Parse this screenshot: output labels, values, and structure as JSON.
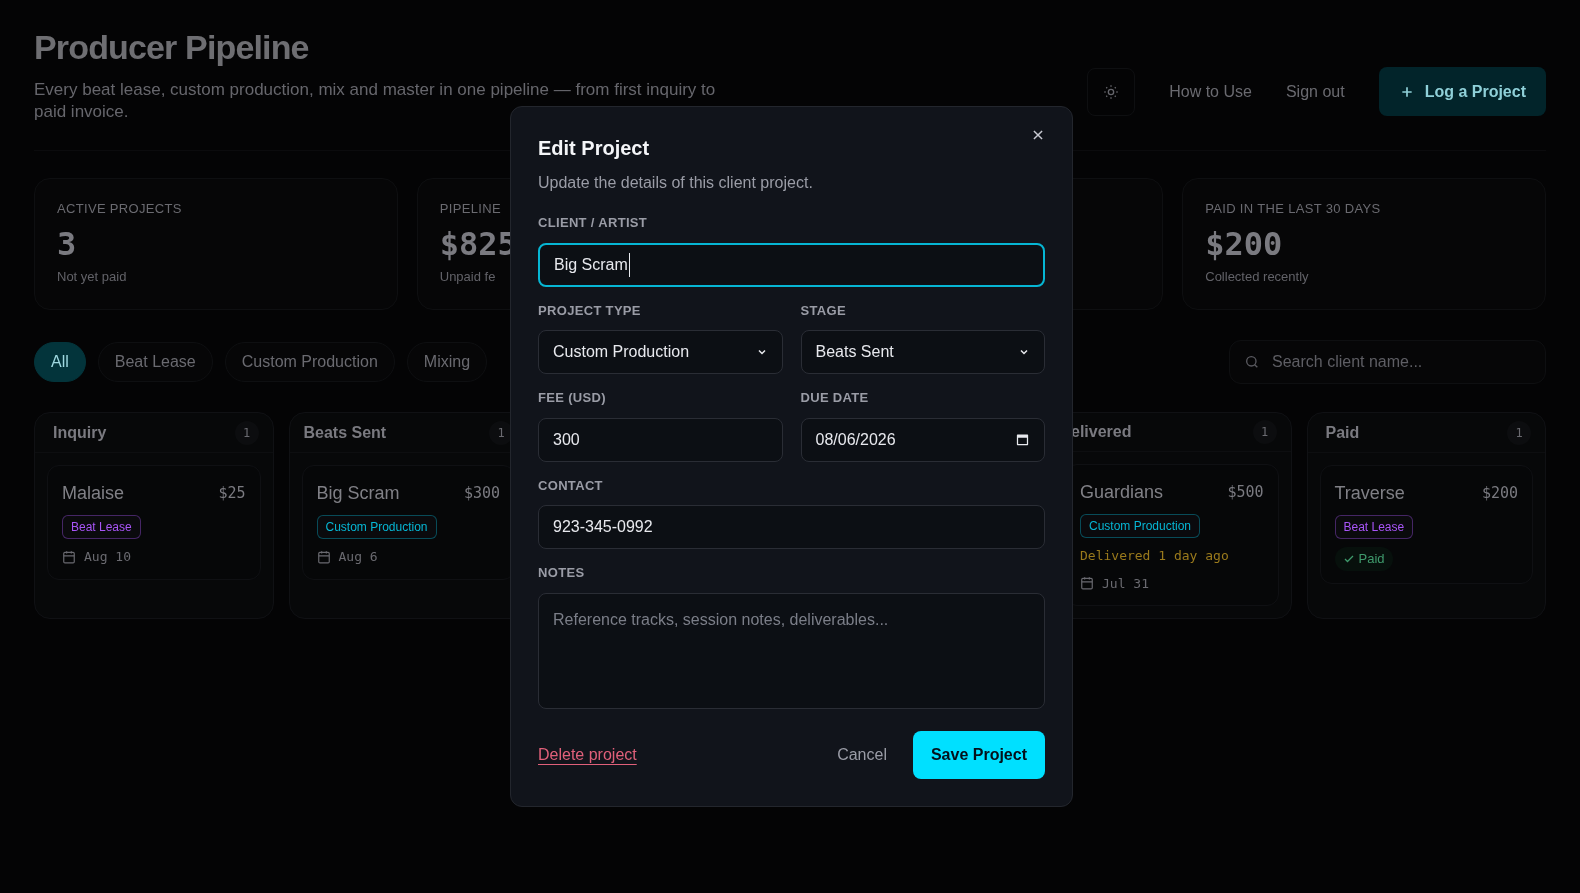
{
  "header": {
    "title": "Producer Pipeline",
    "subtitle": "Every beat lease, custom production, mix and master in one pipeline — from first inquiry to paid invoice.",
    "links": [
      "How to Use",
      "Sign out"
    ],
    "primary_button": "Log a Project"
  },
  "stats": [
    {
      "label": "ACTIVE PROJECTS",
      "value": "3",
      "caption": "Not yet paid"
    },
    {
      "label": "PIPELINE",
      "value": "$825",
      "caption": "Unpaid fe"
    },
    {
      "label": "PAID IN THE LAST 30 DAYS",
      "value": "$200",
      "caption": "Collected recently"
    }
  ],
  "filters": [
    {
      "label": "All",
      "selected": true
    },
    {
      "label": "Beat Lease",
      "selected": false
    },
    {
      "label": "Custom Production",
      "selected": false
    },
    {
      "label": "Mixing",
      "selected": false
    }
  ],
  "search": {
    "placeholder": "Search client name..."
  },
  "columns": [
    {
      "title": "Inquiry",
      "count": "1",
      "cards": [
        {
          "name": "Malaise",
          "amount": "$25",
          "tag": {
            "label": "Beat Lease",
            "color": "#a855f7"
          },
          "due": "Aug 10"
        }
      ]
    },
    {
      "title": "Beats Sent",
      "count": "1",
      "cards": [
        {
          "name": "Big Scram",
          "amount": "$300",
          "tag": {
            "label": "Custom Production",
            "color": "#06b6d4"
          },
          "due": "Aug 6"
        }
      ]
    },
    {
      "title": "elivered",
      "count": "1",
      "cards": [
        {
          "name": "Guardians",
          "amount": "$500",
          "tag": {
            "label": "Custom Production",
            "color": "#06b6d4"
          },
          "alert": "Delivered 1 day ago",
          "due": "Jul 31"
        }
      ]
    },
    {
      "title": "Paid",
      "count": "1",
      "cards": [
        {
          "name": "Traverse",
          "amount": "$200",
          "tag": {
            "label": "Beat Lease",
            "color": "#a855f7"
          },
          "paid": "Paid"
        }
      ]
    }
  ],
  "modal": {
    "title": "Edit Project",
    "description": "Update the details of this client project.",
    "client": {
      "label": "CLIENT / ARTIST",
      "value": "Big Scram",
      "focused": true
    },
    "project_type": {
      "label": "PROJECT TYPE",
      "value": "Custom Production"
    },
    "stage": {
      "label": "STAGE",
      "value": "Beats Sent"
    },
    "fee": {
      "label": "FEE (USD)",
      "value": "300"
    },
    "due_date": {
      "label": "DUE DATE",
      "value": "08/06/2026"
    },
    "contact": {
      "label": "CONTACT",
      "value": "923-345-0992"
    },
    "notes": {
      "label": "NOTES",
      "placeholder": "Reference tracks, session notes, deliverables..."
    },
    "delete": "Delete project",
    "cancel": "Cancel",
    "save": "Save Project"
  }
}
